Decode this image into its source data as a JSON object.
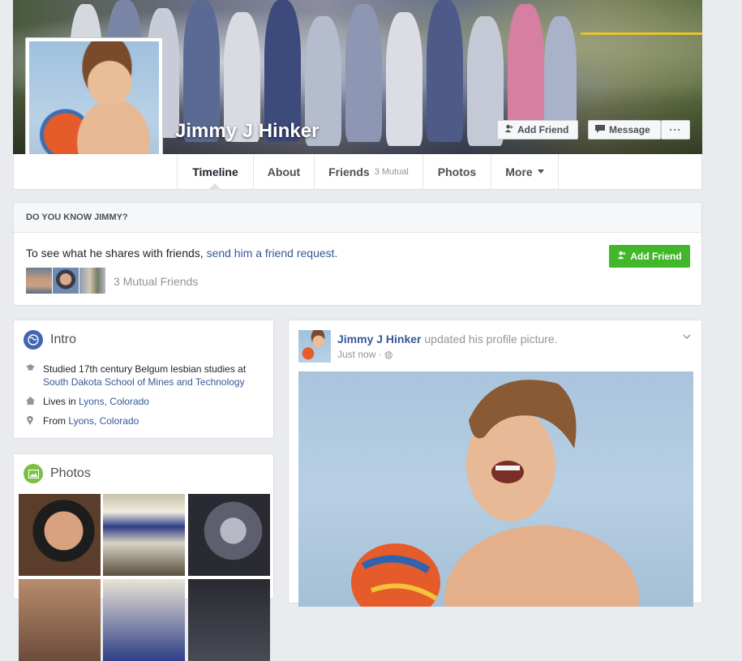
{
  "profile": {
    "name": "Jimmy J Hinker",
    "add_friend_label": "Add Friend",
    "message_label": "Message",
    "more_label": "···"
  },
  "tabs": {
    "timeline": "Timeline",
    "about": "About",
    "friends": "Friends",
    "friends_sub": "3 Mutual",
    "photos": "Photos",
    "more": "More"
  },
  "know": {
    "header": "DO YOU KNOW JIMMY?",
    "text_prefix": "To see what he shares with friends, ",
    "text_link": "send him a friend request.",
    "add_friend_label": "Add Friend",
    "mutual_label": "3 Mutual Friends"
  },
  "intro": {
    "title": "Intro",
    "studied_prefix": "Studied 17th century Belgum lesbian studies at",
    "school": "South Dakota School of Mines and Technology",
    "lives_prefix": "Lives in ",
    "lives_place": "Lyons, Colorado",
    "from_prefix": "From ",
    "from_place": "Lyons, Colorado"
  },
  "photos": {
    "title": "Photos"
  },
  "post": {
    "author": "Jimmy J Hinker",
    "action": " updated his profile picture.",
    "time": "Just now ·",
    "globe": "◍"
  },
  "colors": {
    "link": "#365899",
    "green_button": "#42b72a",
    "secondary_text": "#90949c",
    "background": "#e9ebee"
  },
  "icons": {
    "add_friend": "person-plus-icon",
    "message": "message-icon",
    "intro": "globe-icon",
    "photos": "photo-icon",
    "studied": "graduation-cap-icon",
    "lives": "house-icon",
    "from": "location-pin-icon",
    "audience": "globe-icon",
    "options": "chevron-down-icon"
  }
}
